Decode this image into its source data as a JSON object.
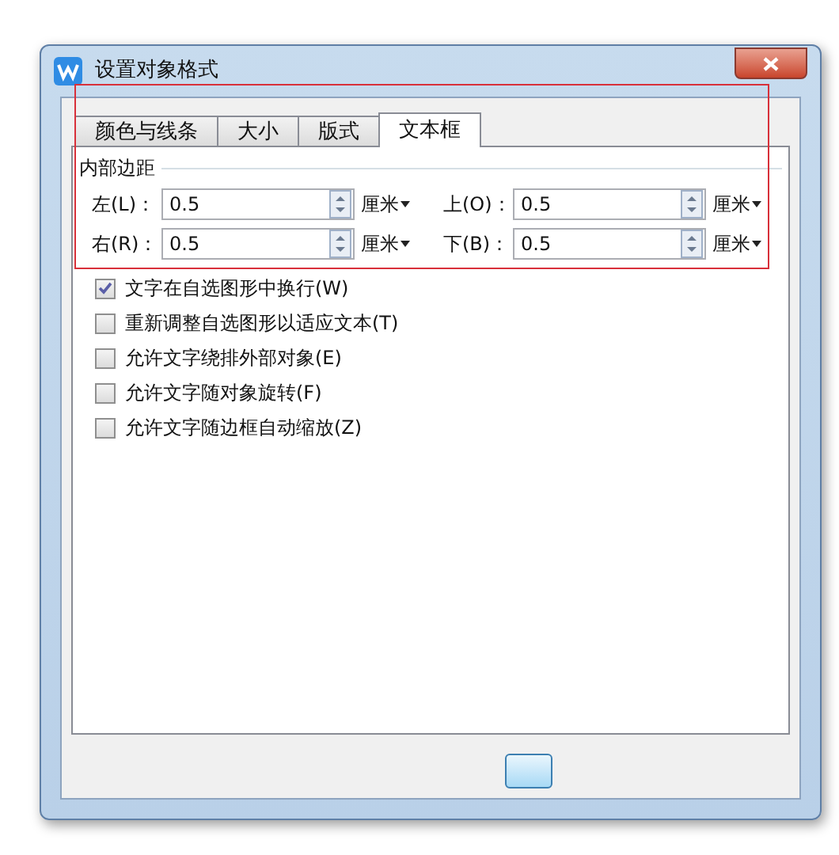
{
  "window": {
    "title": "设置对象格式"
  },
  "tabs": [
    {
      "label": "颜色与线条",
      "selected": false
    },
    {
      "label": "大小",
      "selected": false
    },
    {
      "label": "版式",
      "selected": false
    },
    {
      "label": "文本框",
      "selected": true
    }
  ],
  "margins": {
    "title": "内部边距",
    "fields": [
      {
        "label": "左(L)：",
        "value": "0.5",
        "unit": "厘米"
      },
      {
        "label": "上(O)：",
        "value": "0.5",
        "unit": "厘米"
      },
      {
        "label": "右(R)：",
        "value": "0.5",
        "unit": "厘米"
      },
      {
        "label": "下(B)：",
        "value": "0.5",
        "unit": "厘米"
      }
    ]
  },
  "options": [
    {
      "label": "文字在自选图形中换行(W)",
      "checked": true
    },
    {
      "label": "重新调整自选图形以适应文本(T)",
      "checked": false
    },
    {
      "label": "允许文字绕排外部对象(E)",
      "checked": false
    },
    {
      "label": "允许文字随对象旋转(F)",
      "checked": false
    },
    {
      "label": "允许文字随边框自动缩放(Z)",
      "checked": false
    }
  ]
}
